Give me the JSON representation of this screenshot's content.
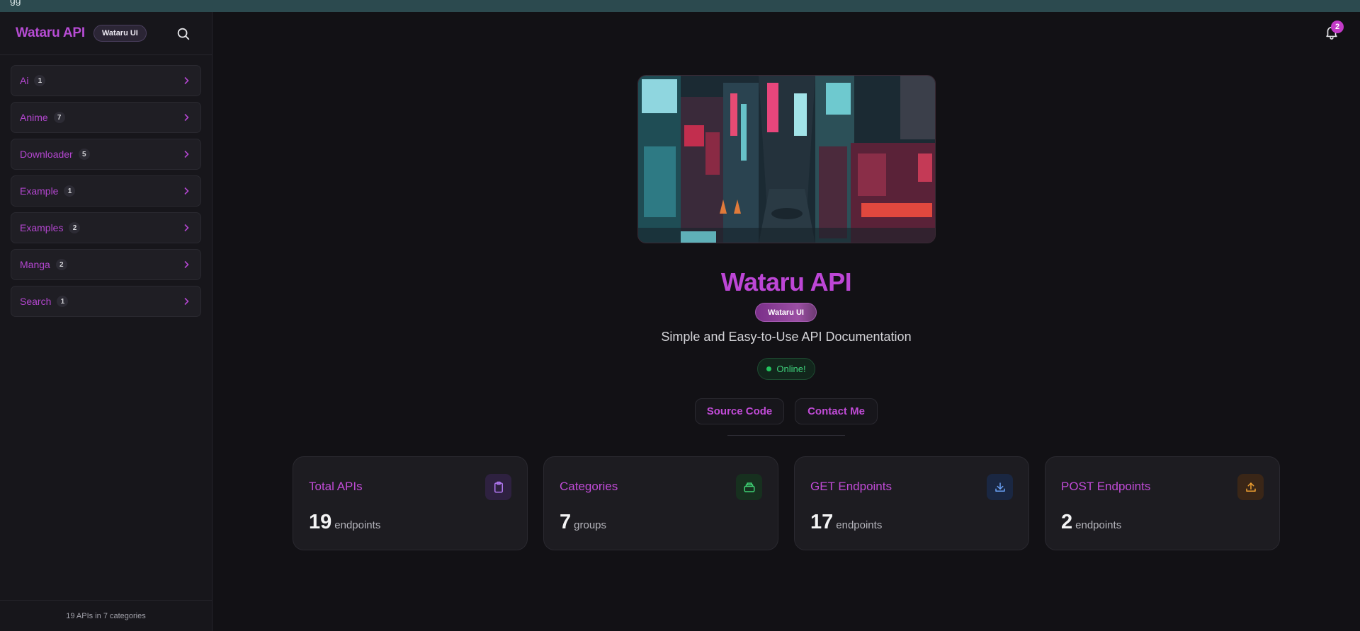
{
  "sidebar": {
    "brand": "Wataru API",
    "badge": "Wataru UI",
    "categories": [
      {
        "name": "Ai",
        "count": "1"
      },
      {
        "name": "Anime",
        "count": "7"
      },
      {
        "name": "Downloader",
        "count": "5"
      },
      {
        "name": "Example",
        "count": "1"
      },
      {
        "name": "Examples",
        "count": "2"
      },
      {
        "name": "Manga",
        "count": "2"
      },
      {
        "name": "Search",
        "count": "1"
      }
    ],
    "footer": "19 APIs in 7 categories"
  },
  "header": {
    "notification_count": "2"
  },
  "hero": {
    "title": "Wataru API",
    "badge": "Wataru UI",
    "subtitle": "Simple and Easy-to-Use API Documentation",
    "status": "Online!",
    "source_button": "Source Code",
    "contact_button": "Contact Me"
  },
  "stats": [
    {
      "title": "Total APIs",
      "value": "19",
      "unit": "endpoints",
      "icon": "clipboard-icon",
      "color": "#a855f7"
    },
    {
      "title": "Categories",
      "value": "7",
      "unit": "groups",
      "icon": "archive-icon",
      "color": "#22c55e"
    },
    {
      "title": "GET Endpoints",
      "value": "17",
      "unit": "endpoints",
      "icon": "download-icon",
      "color": "#3b82f6"
    },
    {
      "title": "POST Endpoints",
      "value": "2",
      "unit": "endpoints",
      "icon": "upload-icon",
      "color": "#f59e0b"
    }
  ],
  "colors": {
    "accent": "#bd46d6",
    "background": "#121115",
    "online": "#22c55e"
  }
}
